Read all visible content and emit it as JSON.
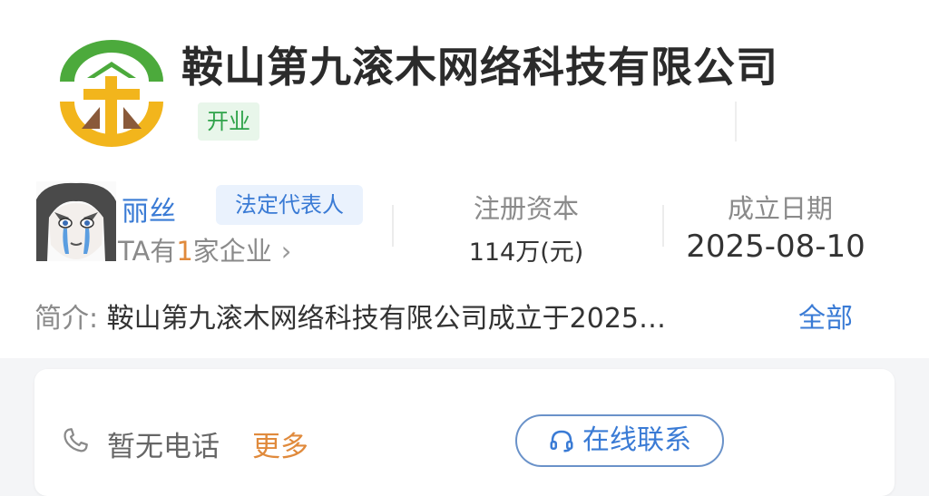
{
  "company": {
    "name": "鞍山第九滚木网络科技有限公司",
    "status": "开业"
  },
  "representative": {
    "name": "丽丝",
    "role_tag": "法定代表人",
    "companies_prefix": "TA有",
    "companies_count": "1",
    "companies_suffix": "家企业",
    "arrow": "›"
  },
  "stats": {
    "capital_label": "注册资本",
    "capital_value": "114万(元)",
    "founded_label": "成立日期",
    "founded_value": "2025-08-10"
  },
  "intro": {
    "label": "简介:",
    "text": "鞍山第九滚木网络科技有限公司成立于2025…",
    "more": "全部"
  },
  "contact": {
    "phone_text": "暂无电话",
    "phone_more": "更多",
    "online_button": "在线联系"
  },
  "colors": {
    "logo_green": "#4caa3c",
    "logo_yellow": "#f2b51c",
    "logo_brown": "#8a5a3a",
    "link_blue": "#3a7bd5",
    "status_green": "#2fa34a",
    "accent_orange": "#e08a3c"
  },
  "icons": {
    "logo": "company-logo",
    "avatar": "anime-avatar",
    "phone": "phone-icon",
    "headset": "headset-icon",
    "chevron": "chevron-right-icon"
  }
}
